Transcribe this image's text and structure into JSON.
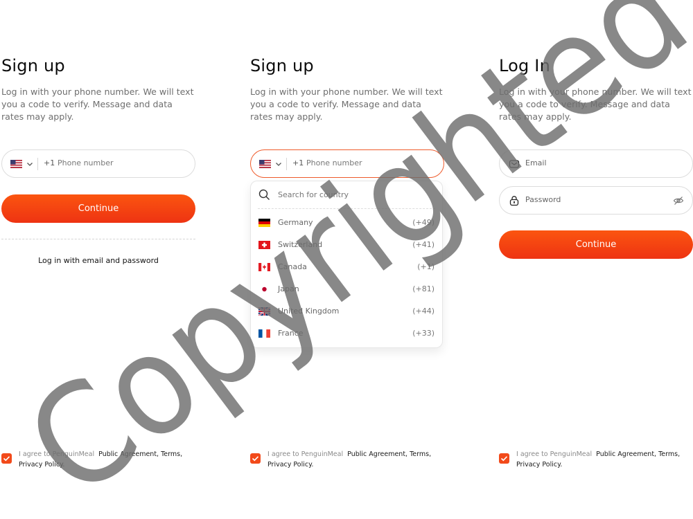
{
  "signup": {
    "title": "Sign up",
    "description": "Log in with your phone number. We will text you a code to verify. Message and data rates may apply.",
    "country_code": "+1",
    "phone_placeholder": "Phone number",
    "continue_label": "Continue",
    "alt_login_label": "Log in with email and password"
  },
  "country_dropdown": {
    "search_placeholder": "Search for country",
    "countries": [
      {
        "name": "Germany",
        "code": "(+49)",
        "flag": "de-flag-icon"
      },
      {
        "name": "Switzerland",
        "code": "(+41)",
        "flag": "ch-flag-icon"
      },
      {
        "name": "Canada",
        "code": "(+1)",
        "flag": "ca-flag-icon"
      },
      {
        "name": "Japan",
        "code": "(+81)",
        "flag": "jp-flag-icon"
      },
      {
        "name": "United Kingdom",
        "code": "(+44)",
        "flag": "gb-flag-icon"
      },
      {
        "name": "France",
        "code": "(+33)",
        "flag": "fr-flag-icon"
      }
    ]
  },
  "login": {
    "title": "Log In",
    "description": "Log in with your phone number. We will text you a code to verify. Message and data rates may apply.",
    "email_placeholder": "Email",
    "password_placeholder": "Password",
    "continue_label": "Continue"
  },
  "agreement": {
    "prefix": "I agree to PenguinMeal",
    "links": "Public Agreement, Terms, Privacy Policy.",
    "checked": true
  },
  "watermark": {
    "text": "Copyrighted"
  },
  "colors": {
    "accent": "#f04a18",
    "accent_gradient_top": "#fb5510",
    "accent_gradient_bottom": "#ee3312",
    "focus_border": "#ef5a2a"
  }
}
